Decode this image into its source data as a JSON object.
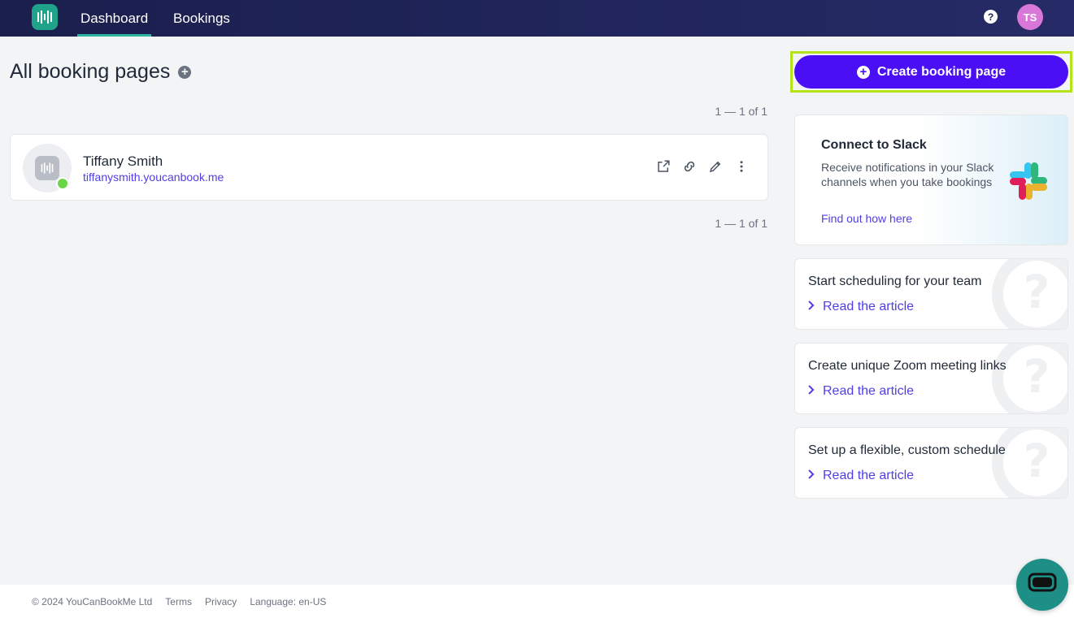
{
  "nav": {
    "tabs": [
      {
        "label": "Dashboard",
        "active": true
      },
      {
        "label": "Bookings",
        "active": false
      }
    ],
    "help_icon": "question-icon",
    "help_glyph": "?",
    "user_initials": "TS"
  },
  "main": {
    "title": "All booking pages",
    "pager_top": "1 — 1 of 1",
    "pager_bottom": "1 — 1 of 1",
    "booking_pages": [
      {
        "name": "Tiffany Smith",
        "url": "tiffanysmith.youcanbook.me",
        "status": "online"
      }
    ]
  },
  "sidebar": {
    "create_label": "Create booking page",
    "slack": {
      "title": "Connect to Slack",
      "description": "Receive notifications in your Slack channels when you take bookings",
      "link": "Find out how here"
    },
    "articles": [
      {
        "title": "Start scheduling for your team",
        "link": "Read the article"
      },
      {
        "title": "Create unique Zoom meeting links",
        "link": "Read the article"
      },
      {
        "title": "Set up a flexible, custom schedule",
        "link": "Read the article"
      }
    ]
  },
  "footer": {
    "copyright": "© 2024 YouCanBookMe Ltd",
    "terms": "Terms",
    "privacy": "Privacy",
    "language": "Language: en-US"
  },
  "colors": {
    "nav_bg": "#1a1f4d",
    "accent": "#4a0ff5",
    "link": "#4f3fe6",
    "highlight": "#b6e21a",
    "status_online": "#6cd64a",
    "chat": "#1e8f86"
  }
}
